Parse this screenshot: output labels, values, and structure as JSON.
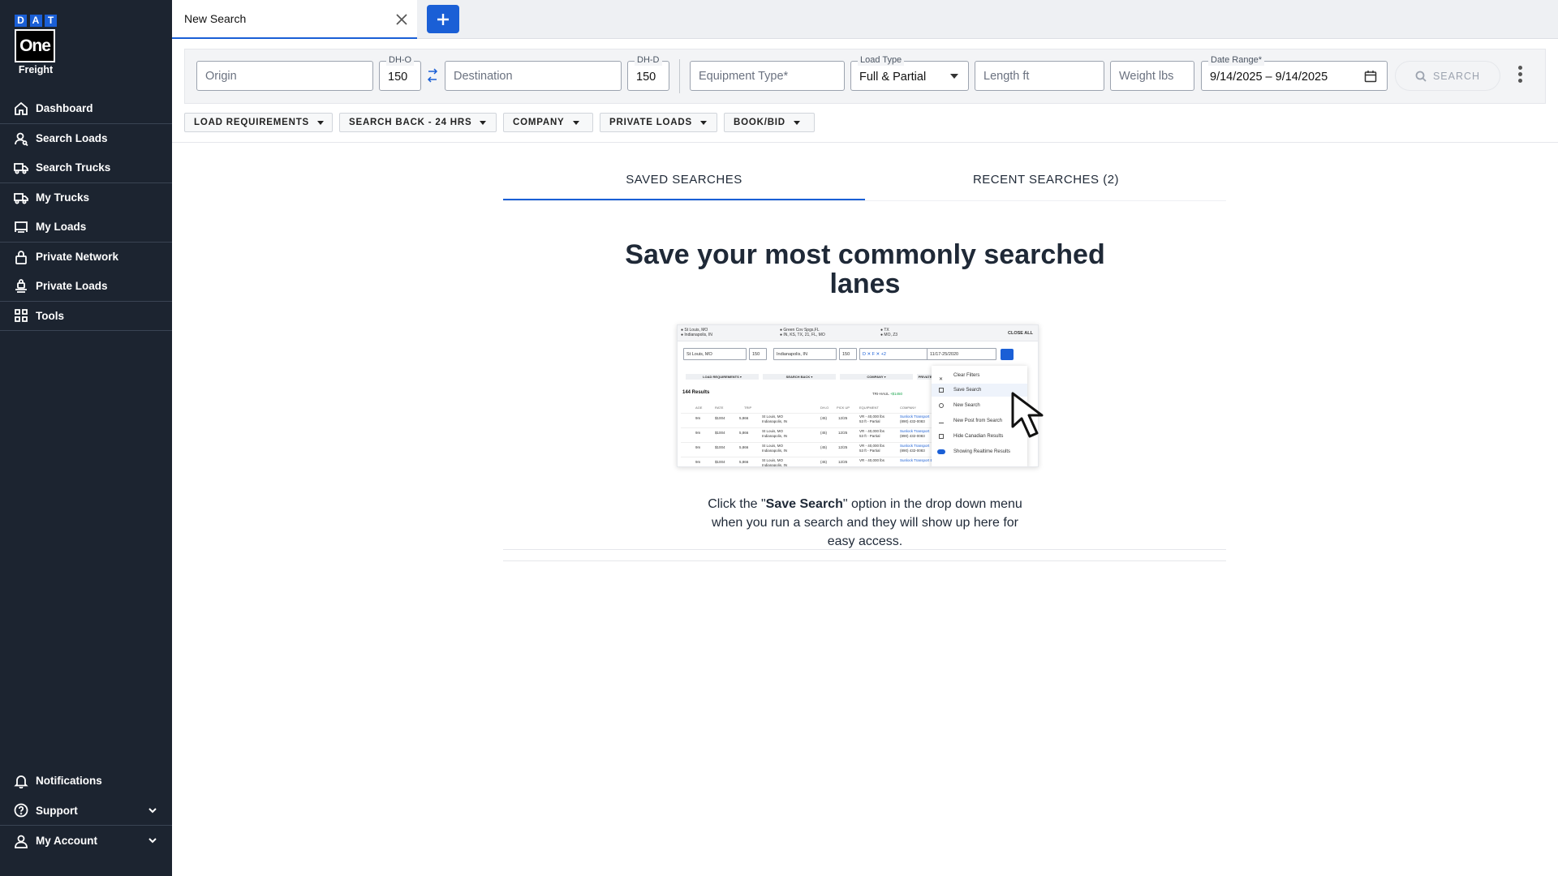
{
  "brand": {
    "letters": [
      "D",
      "A",
      "T"
    ],
    "box": "One",
    "sub": "Freight",
    "accent": "#1a5fd6",
    "sidebar_bg": "#1c2430"
  },
  "sidebar": {
    "items": [
      {
        "label": "Dashboard",
        "icon": "home-icon"
      },
      {
        "label": "Search Loads",
        "icon": "person-search-icon"
      },
      {
        "label": "Search Trucks",
        "icon": "truck-search-icon"
      },
      {
        "label": "My Trucks",
        "icon": "truck-icon"
      },
      {
        "label": "My Loads",
        "icon": "trailer-icon"
      },
      {
        "label": "Private Network",
        "icon": "lock-icon"
      },
      {
        "label": "Private Loads",
        "icon": "private-truck-icon"
      },
      {
        "label": "Tools",
        "icon": "grid-icon"
      }
    ],
    "bottom": [
      {
        "label": "Notifications",
        "icon": "bell-icon"
      },
      {
        "label": "Support",
        "icon": "help-circle-icon"
      },
      {
        "label": "My Account",
        "icon": "user-icon"
      }
    ]
  },
  "tabs": {
    "active_label": "New Search"
  },
  "form": {
    "origin_placeholder": "Origin",
    "dho_label": "DH-O",
    "dho_value": "150",
    "destination_placeholder": "Destination",
    "dhd_label": "DH-D",
    "dhd_value": "150",
    "equipment_placeholder": "Equipment Type*",
    "load_type_label": "Load Type",
    "load_type_value": "Full & Partial",
    "length_placeholder": "Length ft",
    "weight_placeholder": "Weight lbs",
    "date_label": "Date Range*",
    "date_value": "9/14/2025 – 9/14/2025",
    "search_label": "SEARCH"
  },
  "filters": [
    "LOAD REQUIREMENTS",
    "SEARCH BACK - 24 HRS",
    "COMPANY",
    "PRIVATE LOADS",
    "BOOK/BID"
  ],
  "content_tabs": {
    "saved": "SAVED SEARCHES",
    "recent": "RECENT SEARCHES (2)"
  },
  "empty_state": {
    "heading": "Save your most commonly searched lanes",
    "desc_pre": "Click the \"",
    "desc_bold": "Save Search",
    "desc_post": "\" option in the drop down menu when you run a search and they will show up here for easy access."
  },
  "illustration": {
    "tab1_line1": "● St Louis, MO",
    "tab1_line2": "● Indianapolis, IN",
    "tab2_line1": "● Green Cov Spgs,FL",
    "tab2_line2": "● IN, KS, TX, 21, FL, MO",
    "tab3_line1": "● TX",
    "tab3_line2": "● MO, Z3",
    "close_all": "CLOSE ALL",
    "origin": "St Louis, MO",
    "dh1": "150",
    "destination": "Indianapolis, IN",
    "dh2": "150",
    "equip": "D ✕   F ✕   +2",
    "date": "11/17-25/2020",
    "chips": [
      "LOAD REQUIREMENTS ▾",
      "SEARCH BACK ▾",
      "COMPANY ▾",
      "PRIVATE"
    ],
    "results": "144 Results",
    "tri_haul": "TRI-HAUL",
    "tri_haul_value": "+$1450",
    "headers": [
      "AGE",
      "RATE",
      "TRIP",
      "DH-O",
      "PICK UP",
      "EQUIPMENT",
      "COMPANY"
    ],
    "rows": [
      {
        "age": "9m",
        "rate": "$1004",
        "trip": "5,866",
        "o": "St Louis, MO",
        "d": "Indianapolis, IN",
        "dh": "(45)",
        "pu": "12/25",
        "eq": "VR - 40,000 lbs",
        "eq2": "53 ft - Partial",
        "co": "Sunlock Transport",
        "ph": "(890) 432-0083"
      },
      {
        "age": "9m",
        "rate": "$1004",
        "trip": "5,866",
        "o": "St Louis, MO",
        "d": "Indianapolis, IN",
        "dh": "(45)",
        "pu": "12/25",
        "eq": "VR - 40,000 lbs",
        "eq2": "53 ft - Partial",
        "co": "Sunlock Transport",
        "ph": "(890) 432-0083"
      },
      {
        "age": "9m",
        "rate": "$1004",
        "trip": "5,866",
        "o": "St Louis, MO",
        "d": "Indianapolis, IN",
        "dh": "(45)",
        "pu": "12/25",
        "eq": "VR - 40,000 lbs",
        "eq2": "53 ft - Partial",
        "co": "Sunlock Transport",
        "ph": "(890) 432-0083"
      },
      {
        "age": "9m",
        "rate": "$1004",
        "trip": "5,866",
        "o": "St Louis, MO",
        "d": "Indianapolis, IN",
        "dh": "(45)",
        "pu": "12/25",
        "eq": "VR - 40,000 lbs",
        "eq2": "",
        "co": "Sunlock Transport Brokerage",
        "ph": ""
      }
    ],
    "menu": [
      "Clear Filters",
      "Save Search",
      "New Search",
      "New Post from Search",
      "Hide Canadian Results",
      "Showing Realtime Results"
    ]
  }
}
